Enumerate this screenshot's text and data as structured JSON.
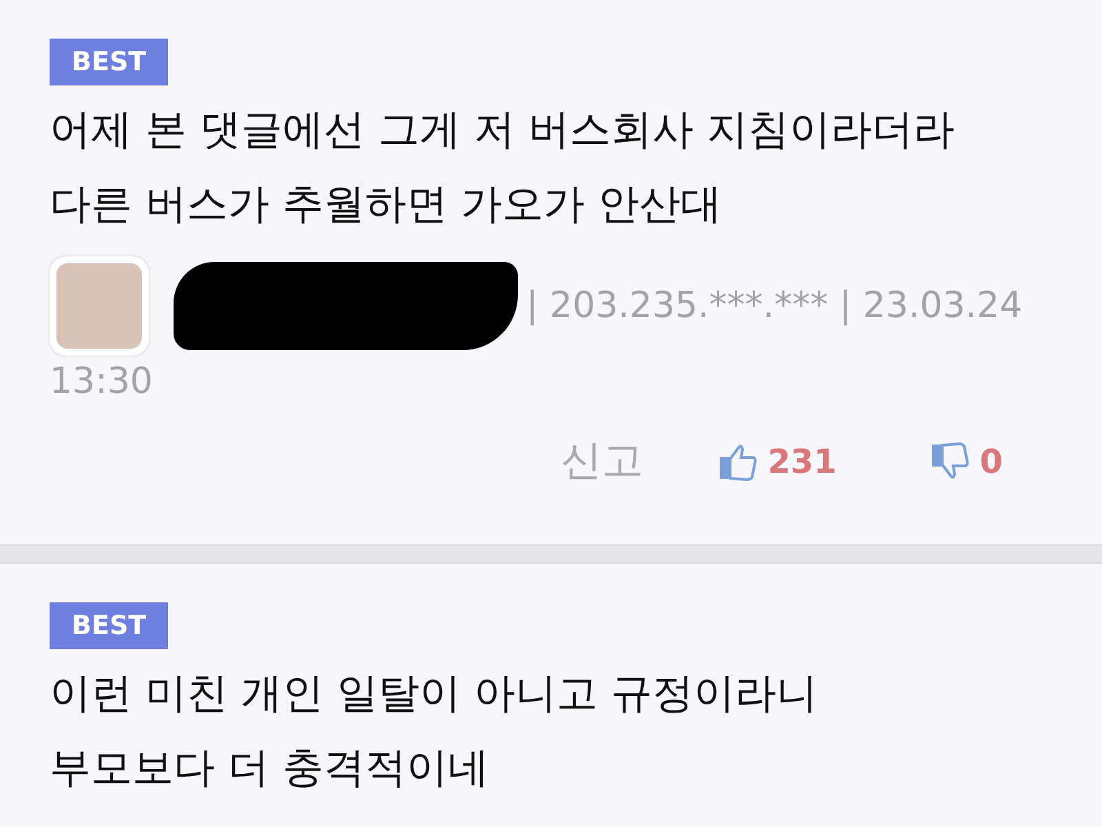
{
  "comments": [
    {
      "badge": "BEST",
      "text_lines": [
        "어제 본 댓글에선 그게 저 버스회사 지침이라더라",
        "다른 버스가 추월하면 가오가 안산대"
      ],
      "meta": {
        "ip_date": "| 203.235.***.*** | 23.03.24",
        "time": "13:30"
      },
      "actions": {
        "report": "신고",
        "likes": "231",
        "dislikes": "0"
      }
    },
    {
      "badge": "BEST",
      "text_lines": [
        "이런 미친 개인 일탈이 아니고 규정이라니",
        "부모보다 더 충격적이네"
      ]
    }
  ]
}
